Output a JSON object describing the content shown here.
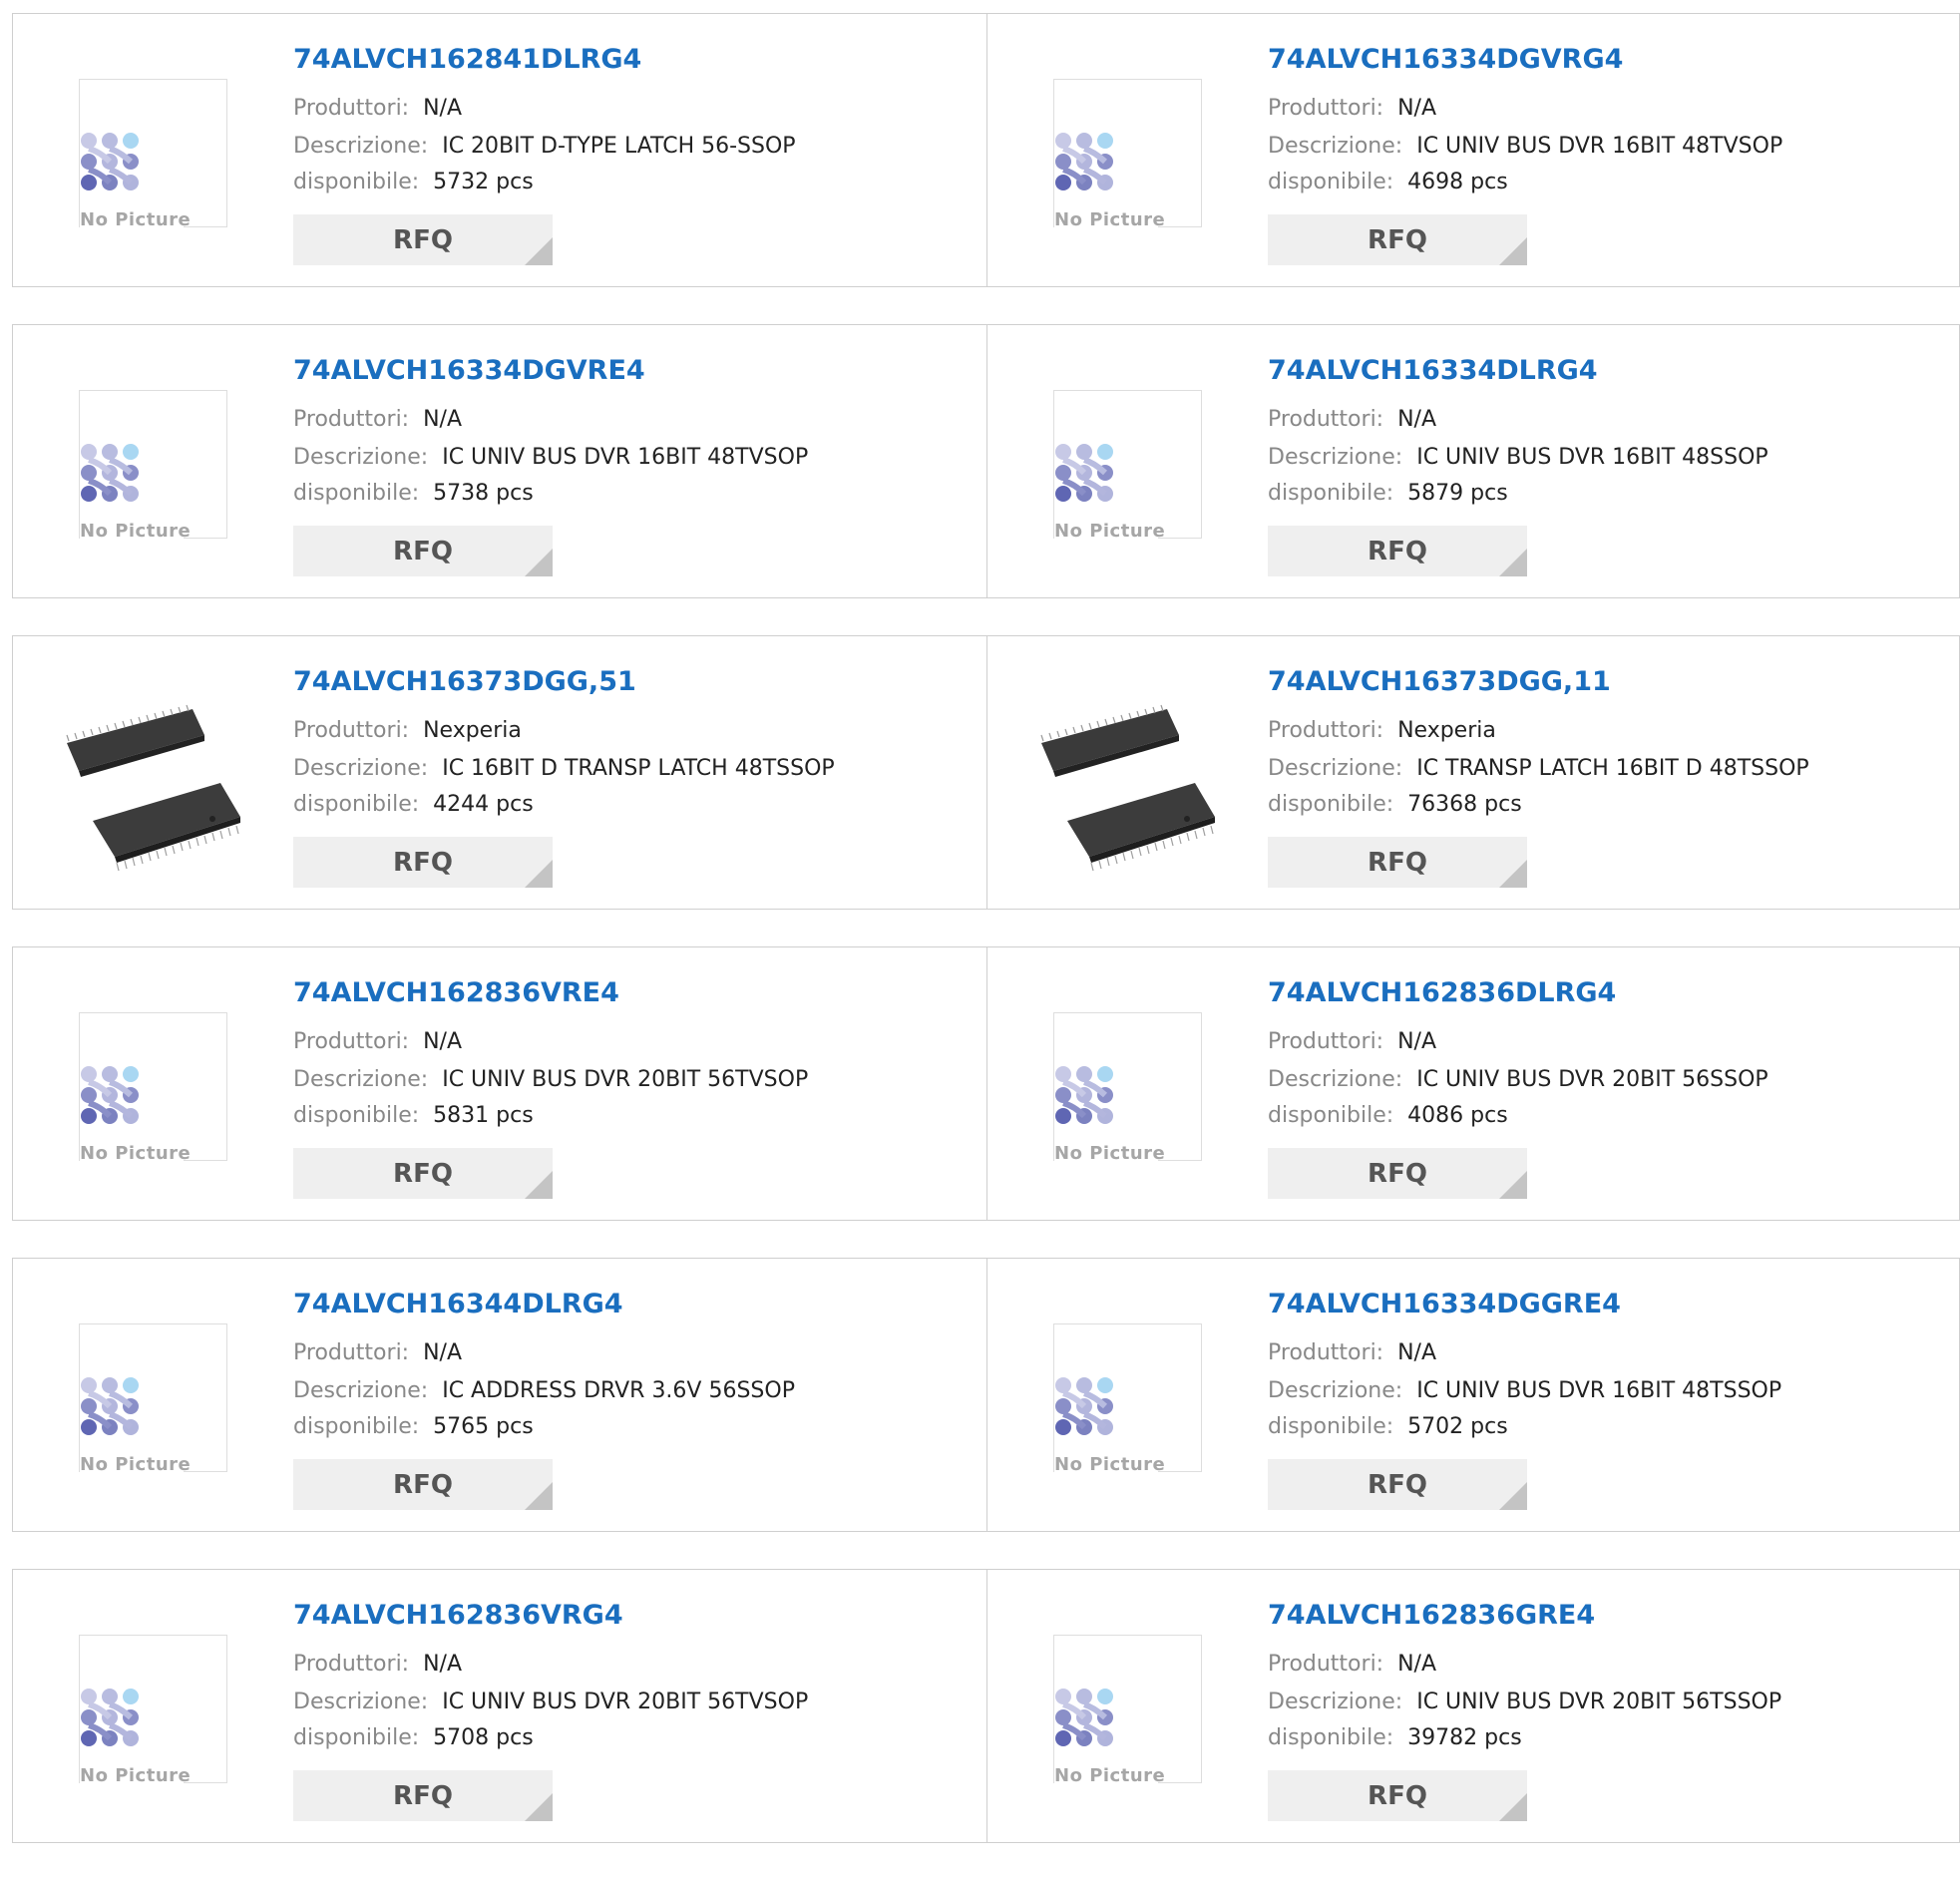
{
  "labels": {
    "manufacturer": "Produttori:",
    "description": "Descrizione:",
    "available": "disponibile:",
    "rfq": "RFQ",
    "no_picture": "No Picture"
  },
  "products": [
    {
      "title": "74ALVCH162841DLRG4",
      "manufacturer": "N/A",
      "description": "IC 20BIT D-TYPE LATCH 56-SSOP",
      "available": "5732 pcs",
      "image": "no-picture"
    },
    {
      "title": "74ALVCH16334DGVRG4",
      "manufacturer": "N/A",
      "description": "IC UNIV BUS DVR 16BIT 48TVSOP",
      "available": "4698 pcs",
      "image": "no-picture"
    },
    {
      "title": "74ALVCH16334DGVRE4",
      "manufacturer": "N/A",
      "description": "IC UNIV BUS DVR 16BIT 48TVSOP",
      "available": "5738 pcs",
      "image": "no-picture"
    },
    {
      "title": "74ALVCH16334DLRG4",
      "manufacturer": "N/A",
      "description": "IC UNIV BUS DVR 16BIT 48SSOP",
      "available": "5879 pcs",
      "image": "no-picture"
    },
    {
      "title": "74ALVCH16373DGG,51",
      "manufacturer": "Nexperia",
      "description": "IC 16BIT D TRANSP LATCH 48TSSOP",
      "available": "4244 pcs",
      "image": "chip"
    },
    {
      "title": "74ALVCH16373DGG,11",
      "manufacturer": "Nexperia",
      "description": "IC TRANSP LATCH 16BIT D 48TSSOP",
      "available": "76368 pcs",
      "image": "chip"
    },
    {
      "title": "74ALVCH162836VRE4",
      "manufacturer": "N/A",
      "description": "IC UNIV BUS DVR 20BIT 56TVSOP",
      "available": "5831 pcs",
      "image": "no-picture"
    },
    {
      "title": "74ALVCH162836DLRG4",
      "manufacturer": "N/A",
      "description": "IC UNIV BUS DVR 20BIT 56SSOP",
      "available": "4086 pcs",
      "image": "no-picture"
    },
    {
      "title": "74ALVCH16344DLRG4",
      "manufacturer": "N/A",
      "description": "IC ADDRESS DRVR 3.6V 56SSOP",
      "available": "5765 pcs",
      "image": "no-picture"
    },
    {
      "title": "74ALVCH16334DGGRE4",
      "manufacturer": "N/A",
      "description": "IC UNIV BUS DVR 16BIT 48TSSOP",
      "available": "5702 pcs",
      "image": "no-picture"
    },
    {
      "title": "74ALVCH162836VRG4",
      "manufacturer": "N/A",
      "description": "IC UNIV BUS DVR 20BIT 56TVSOP",
      "available": "5708 pcs",
      "image": "no-picture"
    },
    {
      "title": "74ALVCH162836GRE4",
      "manufacturer": "N/A",
      "description": "IC UNIV BUS DVR 20BIT 56TSSOP",
      "available": "39782 pcs",
      "image": "no-picture"
    }
  ],
  "colors": {
    "title": "#1a6ebf",
    "label": "#888888",
    "value": "#222222",
    "rfq_bg": "#efefef",
    "rfq_text": "#555555",
    "border": "#cfcfcf"
  }
}
